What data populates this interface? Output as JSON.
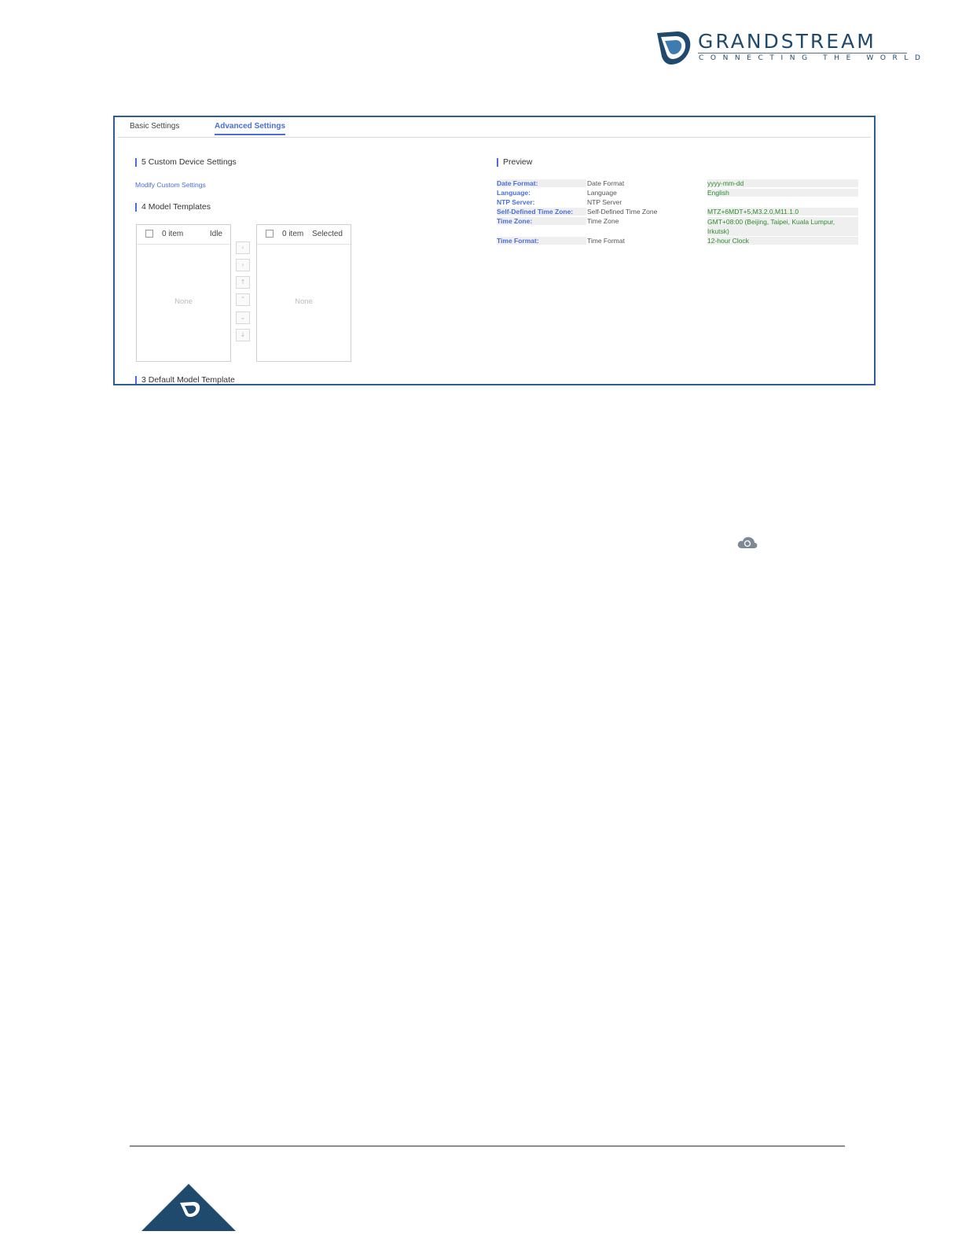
{
  "logo": {
    "wordmark": "GRANDSTREAM",
    "tagline": "CONNECTING THE WORLD",
    "brand_color": "#1f4a6e"
  },
  "tabs": [
    {
      "label": "Basic Settings",
      "active": false
    },
    {
      "label": "Advanced Settings",
      "active": true
    }
  ],
  "sections": {
    "custom_device": {
      "title": "5 Custom Device Settings",
      "link": "Modify Custom Settings"
    },
    "model_templates": {
      "title": "4 Model Templates"
    },
    "default_model": {
      "title": "3 Default Model Template"
    },
    "preview": {
      "title": "Preview"
    }
  },
  "transfer": {
    "left": {
      "count": "0 item",
      "state": "Idle",
      "empty": "None"
    },
    "right": {
      "count": "0 item",
      "state": "Selected",
      "empty": "None"
    },
    "operations": [
      "‹",
      "›",
      "↑",
      "⌃",
      "⌄",
      "↓"
    ]
  },
  "preview_rows": [
    {
      "key": "Date Format:",
      "name": "Date Format",
      "value": "yyyy-mm-dd"
    },
    {
      "key": "Language:",
      "name": "Language",
      "value": "English"
    },
    {
      "key": "NTP Server:",
      "name": "NTP Server",
      "value": ""
    },
    {
      "key": "Self-Defined Time Zone:",
      "name": "Self-Defined Time Zone",
      "value": "MTZ+6MDT+5,M3.2.0,M11.1.0"
    },
    {
      "key": "Time Zone:",
      "name": "Time Zone",
      "value": "GMT+08:00 (Beijing, Taipei, Kuala Lumpur, Irkutsk)"
    },
    {
      "key": "Time Format:",
      "name": "Time Format",
      "value": "12-hour Clock"
    }
  ],
  "colors": {
    "accent": "#4a6fd6",
    "frame_border": "#2e5c9a",
    "value_green": "#2e8b2e"
  },
  "icons": {
    "cloud": "cloud-sync-icon",
    "footer_logo": "grandstream-g-icon"
  }
}
